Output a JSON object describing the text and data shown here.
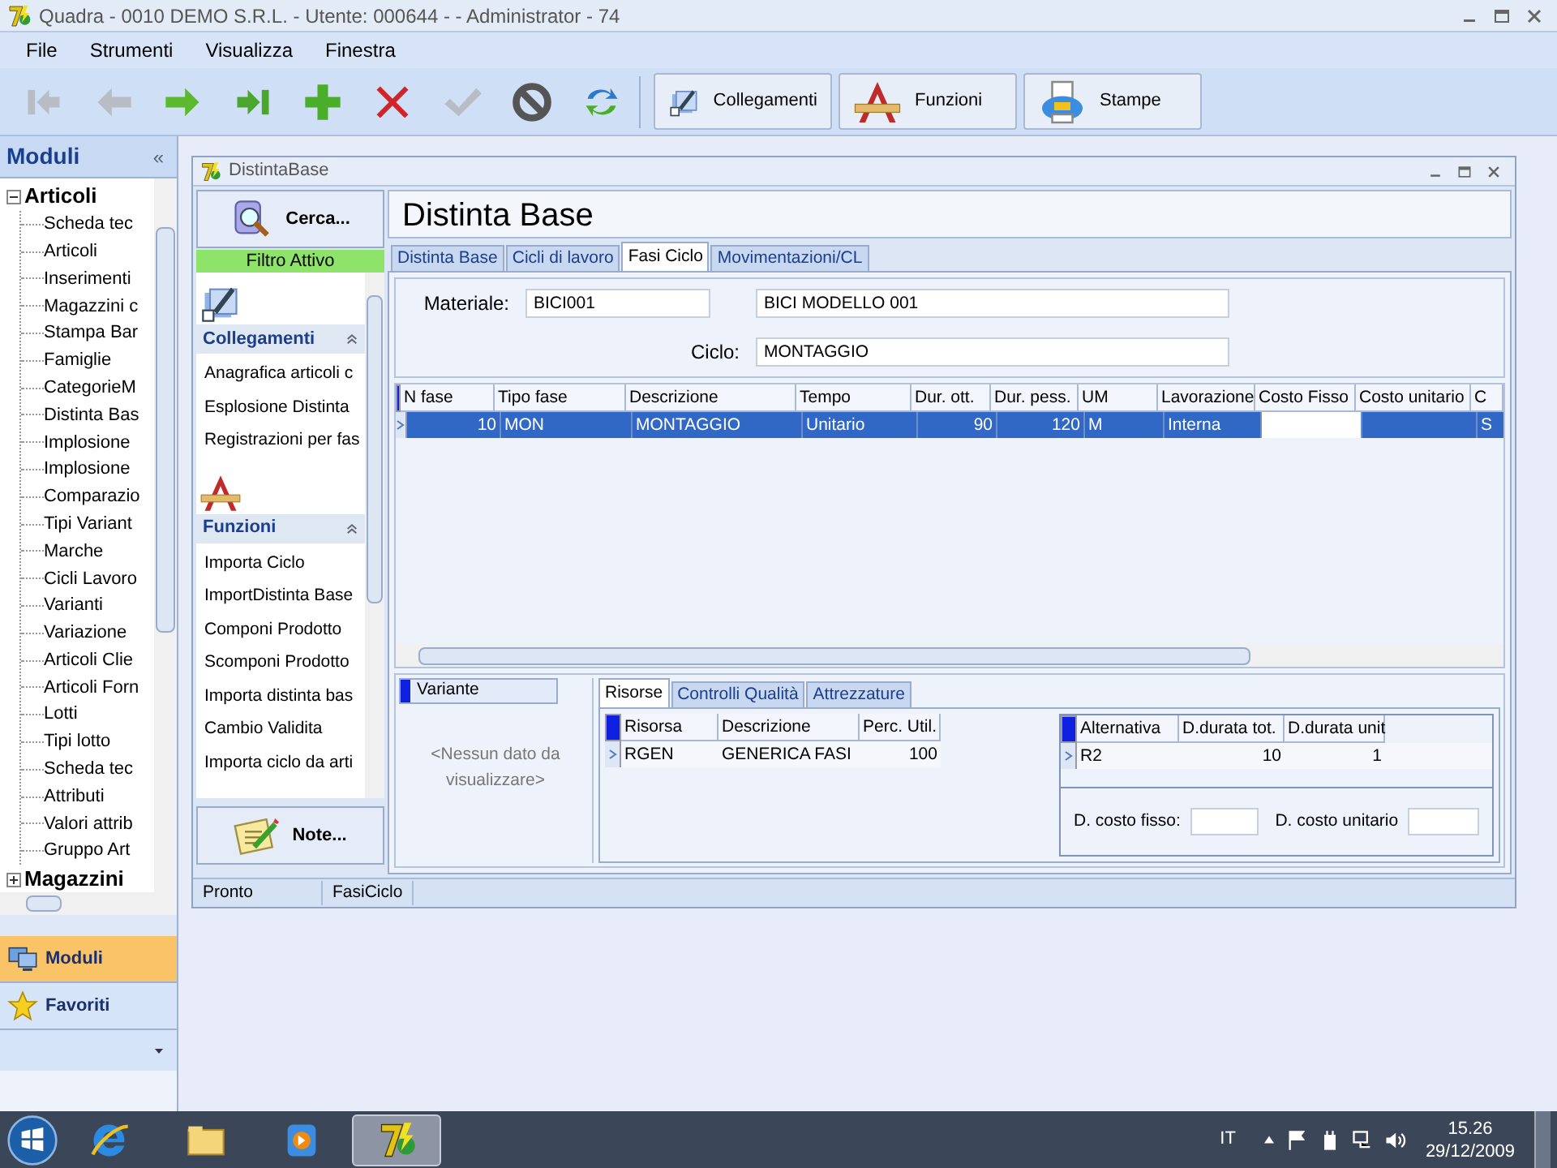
{
  "window": {
    "title": "Quadra - 0010 DEMO S.R.L. - Utente: 000644 -  - Administrator - 74"
  },
  "menu": [
    "File",
    "Strumenti",
    "Visualizza",
    "Finestra"
  ],
  "toolbar": [
    {
      "kind": "first",
      "disabled": true
    },
    {
      "kind": "prev",
      "disabled": true
    },
    {
      "kind": "next",
      "disabled": false
    },
    {
      "kind": "last",
      "disabled": false
    },
    {
      "kind": "add",
      "disabled": false
    },
    {
      "kind": "delete",
      "disabled": false
    },
    {
      "kind": "confirm",
      "disabled": true
    },
    {
      "kind": "cancel",
      "disabled": false
    },
    {
      "kind": "refresh",
      "disabled": false
    }
  ],
  "toolbar_buttons": [
    {
      "kind": "links",
      "label": "Collegamenti"
    },
    {
      "kind": "functions",
      "label": "Funzioni"
    },
    {
      "kind": "print",
      "label": "Stampe"
    }
  ],
  "sidebar": {
    "title": "Moduli",
    "collapse": "«",
    "tree": [
      {
        "label": "Articoli",
        "expanded": true,
        "children": [
          {
            "label": "Scheda tec"
          },
          {
            "label": "Articoli"
          },
          {
            "label": "Inserimenti"
          },
          {
            "label": "Magazzini c"
          },
          {
            "label": "Stampa Bar"
          },
          {
            "label": "Famiglie"
          },
          {
            "label": "CategorieM"
          },
          {
            "label": "Distinta Bas"
          },
          {
            "label": "Implosione"
          },
          {
            "label": "Implosione"
          },
          {
            "label": "Comparazio"
          },
          {
            "label": "Tipi Variant"
          },
          {
            "label": "Marche"
          },
          {
            "label": "Cicli Lavoro"
          },
          {
            "label": "Varianti"
          },
          {
            "label": "Variazione"
          },
          {
            "label": "Articoli Clie"
          },
          {
            "label": "Articoli Forn"
          },
          {
            "label": "Lotti"
          },
          {
            "label": "Tipi lotto"
          },
          {
            "label": "Scheda tec"
          },
          {
            "label": "Attributi"
          },
          {
            "label": "Valori attrib"
          },
          {
            "label": "Gruppo Art"
          }
        ]
      },
      {
        "label": "Magazzini",
        "expanded": false
      }
    ],
    "nav": [
      {
        "kind": "modules",
        "label": "Moduli",
        "selected": true
      },
      {
        "kind": "favorites",
        "label": "Favoriti",
        "selected": false
      }
    ]
  },
  "child_window": {
    "title": "DistintaBase",
    "search_button": "Cerca...",
    "filter_status": "Filtro Attivo",
    "groups": [
      {
        "kind": "links",
        "title": "Collegamenti",
        "expanded": true,
        "items": [
          "Anagrafica articoli c",
          "Esplosione Distinta",
          "Registrazioni per fas"
        ]
      },
      {
        "kind": "functions",
        "title": "Funzioni",
        "expanded": true,
        "items": [
          "Importa Ciclo",
          "ImportDistinta Base",
          "Componi Prodotto",
          "Scomponi Prodotto",
          "Importa distinta bas",
          "Cambio Validita",
          "Importa ciclo da arti"
        ]
      }
    ],
    "notes_button": "Note...",
    "heading": "Distinta Base",
    "tabs": [
      {
        "label": "Distinta Base",
        "selected": false
      },
      {
        "label": "Cicli di lavoro",
        "selected": false
      },
      {
        "label": "Fasi Ciclo",
        "selected": true
      },
      {
        "label": "Movimentazioni/CL",
        "selected": false
      }
    ],
    "form": {
      "material_label": "Materiale:",
      "material_code": "BICI001",
      "material_description": "BICI MODELLO 001",
      "cycle_label": "Ciclo:",
      "cycle": "MONTAGGIO"
    },
    "table": {
      "columns": [
        "N fase",
        "Tipo fase",
        "Descrizione",
        "Tempo",
        "Dur. ott.",
        "Dur. pess.",
        "UM",
        "Lavorazione",
        "Costo Fisso",
        "Costo unitario",
        "C"
      ],
      "rows": [
        {
          "selected": true,
          "cells": [
            "10",
            "MON",
            "MONTAGGIO",
            "Unitario",
            "90",
            "120",
            "M",
            "Interna",
            "",
            "",
            "S"
          ]
        }
      ]
    },
    "variant": {
      "header": "Variante",
      "empty": "<Nessun dato da visualizzare>"
    },
    "subtabs": [
      {
        "label": "Risorse",
        "selected": true
      },
      {
        "label": "Controlli Qualità",
        "selected": false
      },
      {
        "label": "Attrezzature",
        "selected": false
      }
    ],
    "resources": {
      "columns": [
        "Risorsa",
        "Descrizione",
        "Perc. Util."
      ],
      "rows": [
        [
          "RGEN",
          "GENERICA FASI",
          "100"
        ]
      ]
    },
    "alternatives": {
      "columns": [
        "Alternativa",
        "D.durata tot.",
        "D.durata unit"
      ],
      "rows": [
        [
          "R2",
          "10",
          "1"
        ]
      ]
    },
    "fixed_cost_label": "D. costo fisso:",
    "unit_cost_label": "D. costo unitario",
    "status_bar": [
      "Pronto",
      "FasiCiclo"
    ]
  },
  "taskbar": {
    "apps": [
      {
        "kind": "browser",
        "active": false
      },
      {
        "kind": "folder",
        "active": false
      },
      {
        "kind": "media",
        "active": false
      },
      {
        "kind": "app",
        "active": true
      }
    ],
    "language": "IT",
    "time": "15.26",
    "date": "29/12/2009"
  }
}
